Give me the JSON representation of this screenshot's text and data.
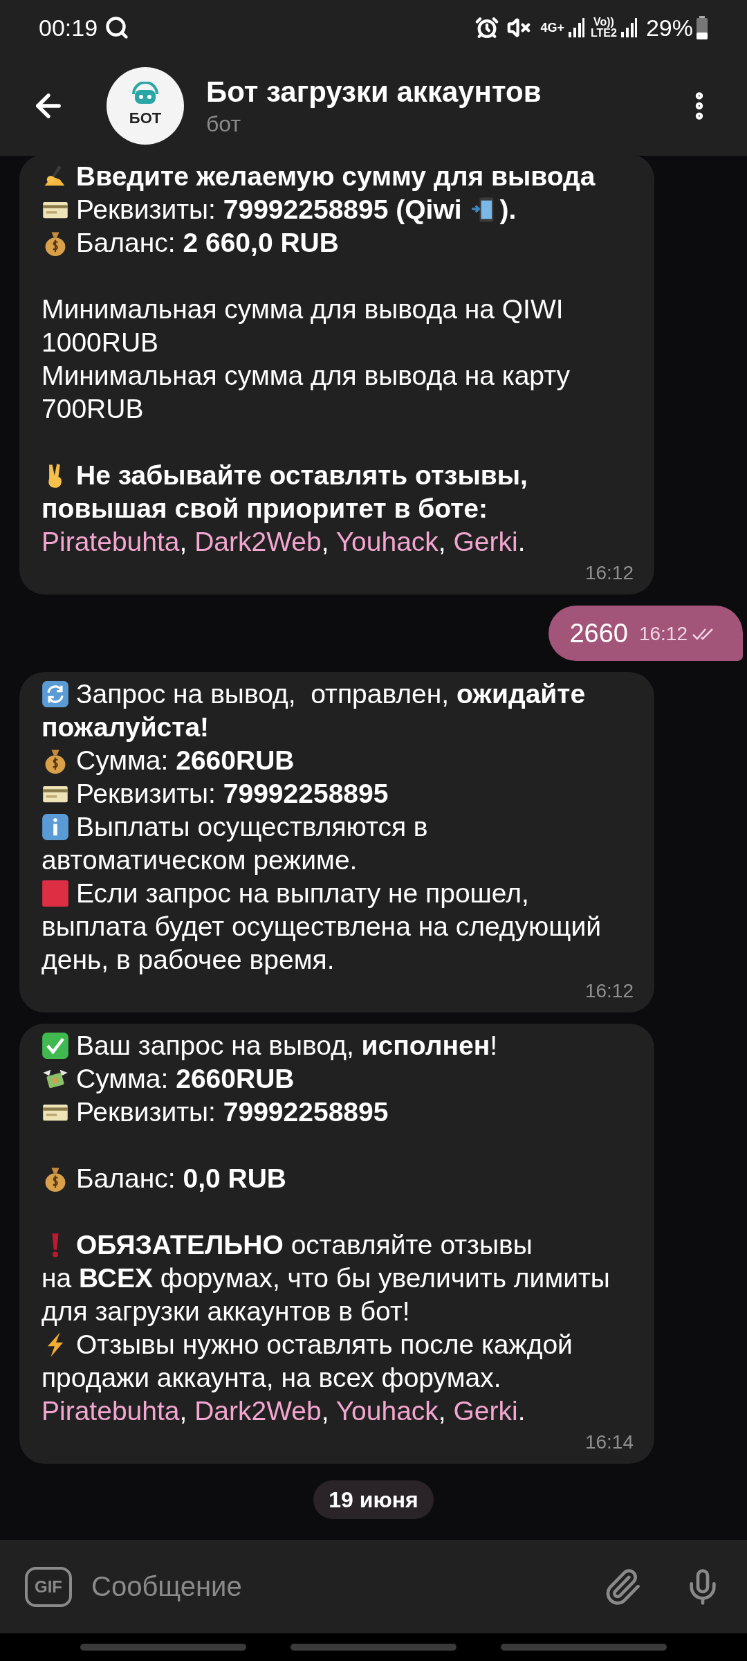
{
  "status_bar": {
    "time": "00:19",
    "network": [
      "4G+",
      "Vo))",
      "LTE2"
    ],
    "battery": "29%"
  },
  "header": {
    "avatar_label": "БОТ",
    "title": "Бот загрузки аккаунтов",
    "subtitle": "бот"
  },
  "messages": [
    {
      "kind": "incoming",
      "time": "16:12",
      "paragraphs": [
        [
          {
            "parts": [
              {
                "kind": "writing"
              },
              {
                "kind": "text",
                "text": "Введите желаемую сумму для вывода",
                "bold": true
              }
            ]
          },
          {
            "parts": [
              {
                "kind": "card"
              },
              {
                "kind": "text",
                "text": "Реквизиты: **79992258895 (Qiwi** "
              },
              {
                "kind": "phone"
              },
              {
                "kind": "text",
                "text": "**).**"
              }
            ]
          },
          {
            "parts": [
              {
                "kind": "moneybag"
              },
              {
                "kind": "text",
                "text": "Баланс: **2 660,0 RUB**"
              }
            ]
          }
        ],
        [
          {
            "parts": [
              {
                "kind": "text",
                "text": "Минимальная сумма для вывода на QIWI"
              }
            ]
          },
          {
            "parts": [
              {
                "kind": "text",
                "text": "1000RUB"
              }
            ]
          },
          {
            "parts": [
              {
                "kind": "text",
                "text": "Минимальная сумма для вывода на карту"
              }
            ]
          },
          {
            "parts": [
              {
                "kind": "text",
                "text": "700RUB"
              }
            ]
          }
        ],
        [
          {
            "parts": [
              {
                "kind": "victory"
              },
              {
                "kind": "text",
                "text": "Не забывайте оставлять отзывы,",
                "bold": true
              }
            ]
          },
          {
            "parts": [
              {
                "kind": "text",
                "text": "повышая свой приоритет в боте:",
                "bold": true
              }
            ]
          },
          {
            "parts": [
              {
                "kind": "link",
                "text": "Piratebuhta"
              },
              {
                "kind": "text",
                "text": ", "
              },
              {
                "kind": "link",
                "text": "Dark2Web"
              },
              {
                "kind": "text",
                "text": ", "
              },
              {
                "kind": "link",
                "text": "Youhack"
              },
              {
                "kind": "text",
                "text": ", "
              },
              {
                "kind": "link",
                "text": "Gerki"
              },
              {
                "kind": "text",
                "text": "."
              }
            ]
          }
        ]
      ]
    },
    {
      "kind": "outgoing",
      "time": "16:12",
      "read": true,
      "paragraphs": [
        [
          {
            "parts": [
              {
                "kind": "text",
                "text": "2660"
              }
            ]
          }
        ]
      ]
    },
    {
      "kind": "incoming",
      "time": "16:12",
      "paragraphs": [
        [
          {
            "parts": [
              {
                "kind": "refresh"
              },
              {
                "kind": "text",
                "text": "Запрос на вывод,  отправлен, **ожидайте**"
              }
            ]
          },
          {
            "parts": [
              {
                "kind": "text",
                "text": "пожалуйста!",
                "bold": true
              }
            ]
          },
          {
            "parts": [
              {
                "kind": "moneybag"
              },
              {
                "kind": "text",
                "text": "Сумма: **2660RUB**"
              }
            ]
          },
          {
            "parts": [
              {
                "kind": "card"
              },
              {
                "kind": "text",
                "text": "Реквизиты: **79992258895**"
              }
            ]
          },
          {
            "parts": [
              {
                "kind": "info"
              },
              {
                "kind": "text",
                "text": "Выплаты осуществляются в"
              }
            ]
          },
          {
            "parts": [
              {
                "kind": "text",
                "text": "автоматическом режиме."
              }
            ]
          },
          {
            "parts": [
              {
                "kind": "stop"
              },
              {
                "kind": "text",
                "text": "Если запрос на выплату не прошел,"
              }
            ]
          },
          {
            "parts": [
              {
                "kind": "text",
                "text": "выплата будет осуществлена на следующий"
              }
            ]
          },
          {
            "parts": [
              {
                "kind": "text",
                "text": "день, в рабочее время."
              }
            ]
          }
        ]
      ]
    },
    {
      "kind": "incoming",
      "time": "16:14",
      "paragraphs": [
        [
          {
            "parts": [
              {
                "kind": "check"
              },
              {
                "kind": "text",
                "text": "Ваш запрос на вывод, **исполнен**!"
              }
            ]
          },
          {
            "parts": [
              {
                "kind": "wings"
              },
              {
                "kind": "text",
                "text": "Сумма: **2660RUB**"
              }
            ]
          },
          {
            "parts": [
              {
                "kind": "card"
              },
              {
                "kind": "text",
                "text": "Реквизиты: **79992258895**"
              }
            ]
          }
        ],
        [
          {
            "parts": [
              {
                "kind": "moneybag"
              },
              {
                "kind": "text",
                "text": "Баланс: **0,0 RUB**"
              }
            ]
          }
        ],
        [
          {
            "parts": [
              {
                "kind": "exclamation"
              },
              {
                "kind": "text",
                "text": "**ОБЯЗАТЕЛЬНО** оставляйте отзывы"
              }
            ]
          },
          {
            "parts": [
              {
                "kind": "text",
                "text": "на **ВСЕХ** форумах, что бы увеличить лимиты"
              }
            ]
          },
          {
            "parts": [
              {
                "kind": "text",
                "text": "для загрузки аккаунтов в бот!"
              }
            ]
          },
          {
            "parts": [
              {
                "kind": "lightning"
              },
              {
                "kind": "text",
                "text": "Отзывы нужно оставлять после каждой"
              }
            ]
          },
          {
            "parts": [
              {
                "kind": "text",
                "text": "продажи аккаунта, на всех форумах."
              }
            ]
          },
          {
            "parts": [
              {
                "kind": "link",
                "text": "Piratebuhta"
              },
              {
                "kind": "text",
                "text": ", "
              },
              {
                "kind": "link",
                "text": "Dark2Web"
              },
              {
                "kind": "text",
                "text": ", "
              },
              {
                "kind": "link",
                "text": "Youhack"
              },
              {
                "kind": "text",
                "text": ", "
              },
              {
                "kind": "link",
                "text": "Gerki"
              },
              {
                "kind": "text",
                "text": "."
              }
            ]
          }
        ]
      ]
    }
  ],
  "date_divider": "19 июня",
  "composer": {
    "gif_label": "GIF",
    "placeholder": "Сообщение"
  }
}
